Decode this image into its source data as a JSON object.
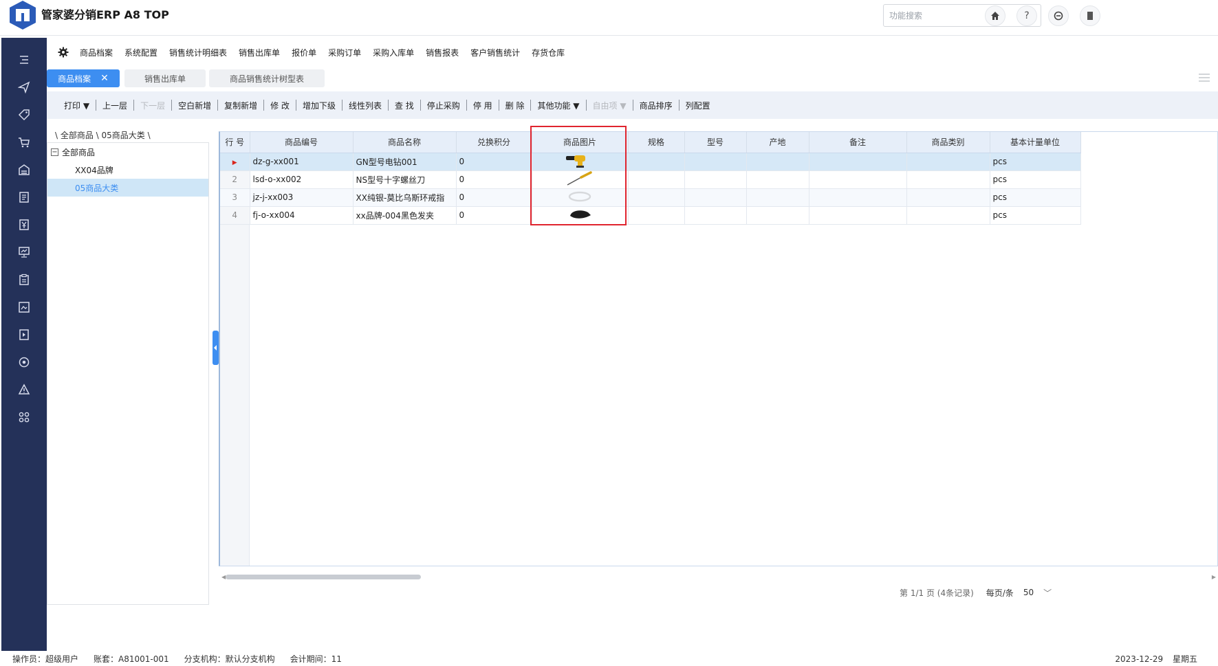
{
  "header": {
    "title": "管家婆分销ERP A8 TOP",
    "search_placeholder": "功能搜索",
    "icons": [
      "home-icon",
      "help-icon",
      "theme-icon",
      "exit-icon"
    ]
  },
  "sidebar": {
    "icons": [
      "menu-list-icon",
      "send-icon",
      "tag-icon",
      "cart-icon",
      "warehouse-icon",
      "document-icon",
      "finance-icon",
      "monitor-chart-icon",
      "clipboard-icon",
      "image-report-icon",
      "task-icon",
      "settings-icon",
      "warning-icon",
      "apps-icon"
    ]
  },
  "menubar": {
    "items": [
      "商品档案",
      "系统配置",
      "销售统计明细表",
      "销售出库单",
      "报价单",
      "采购订单",
      "采购入库单",
      "销售报表",
      "客户销售统计",
      "存货仓库"
    ]
  },
  "tabs": [
    {
      "label": "商品档案",
      "active": true
    },
    {
      "label": "销售出库单",
      "active": false
    },
    {
      "label": "商品销售统计树型表",
      "active": false
    }
  ],
  "toolbar": {
    "print": "打印 ▼",
    "up_level": "上一层",
    "down_level": "下一层",
    "blank_new": "空白新增",
    "copy_new": "复制新增",
    "edit": "修 改",
    "add_sub": "增加下级",
    "linear_list": "线性列表",
    "find": "查 找",
    "stop_purchase": "停止采购",
    "disable": "停 用",
    "delete": "删 除",
    "other": "其他功能 ▼",
    "custom": "自由项 ▼",
    "sort": "商品排序",
    "columns": "列配置"
  },
  "breadcrumb": "\\ 全部商品 \\ 05商品大类 \\",
  "tree": {
    "root": "全部商品",
    "root_toggle": "−",
    "children": [
      {
        "label": "XX04品牌",
        "selected": false
      },
      {
        "label": "05商品大类",
        "selected": true
      }
    ]
  },
  "grid": {
    "columns": [
      "行 号",
      "商品编号",
      "商品名称",
      "兑换积分",
      "商品图片",
      "规格",
      "型号",
      "产地",
      "备注",
      "商品类别",
      "基本计量单位"
    ],
    "rows": [
      {
        "rownum": "",
        "marker": "▶",
        "code": "dz-g-xx001",
        "name": "GN型号电钻001",
        "points": "0",
        "image": "drill-image",
        "unit": "pcs"
      },
      {
        "rownum": "2",
        "marker": "",
        "code": "lsd-o-xx002",
        "name": "NS型号十字螺丝刀",
        "points": "0",
        "image": "screwdriver-image",
        "unit": "pcs"
      },
      {
        "rownum": "3",
        "marker": "",
        "code": "jz-j-xx003",
        "name": "XX纯银-莫比乌斯环戒指",
        "points": "0",
        "image": "ring-image",
        "unit": "pcs"
      },
      {
        "rownum": "4",
        "marker": "",
        "code": "fj-o-xx004",
        "name": "xx品牌-004黑色发夹",
        "points": "0",
        "image": "hairclip-image",
        "unit": "pcs"
      }
    ]
  },
  "pager": {
    "info": "第 1/1 页 (4条记录)",
    "page_size_label": "每页/条",
    "page_size": "50"
  },
  "status": {
    "operator": "操作员：超级用户",
    "account": "账套：A81001-001",
    "branch": "分支机构：默认分支机构",
    "period": "会计期间：11",
    "date": "2023-12-29",
    "weekday": "星期五"
  },
  "colors": {
    "sidebar": "#243159",
    "accent": "#3d8ef1",
    "highlight": "#e0242e",
    "toolbar_bg": "#edf1f8"
  }
}
